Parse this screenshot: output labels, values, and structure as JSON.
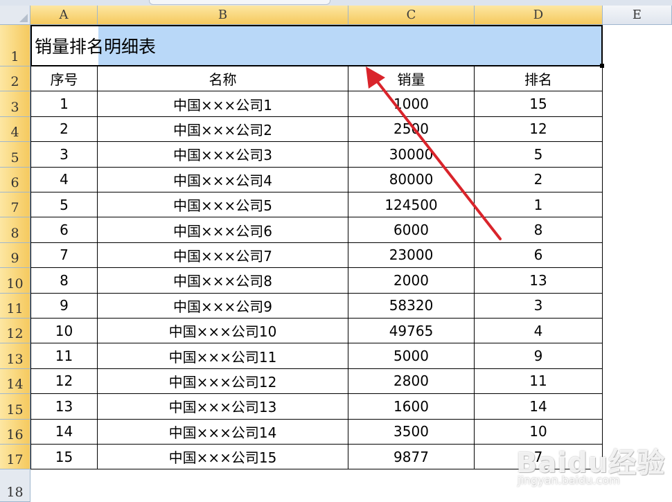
{
  "columns": [
    "A",
    "B",
    "C",
    "D",
    "E"
  ],
  "rows": [
    "1",
    "2",
    "3",
    "4",
    "5",
    "6",
    "7",
    "8",
    "9",
    "10",
    "11",
    "12",
    "13",
    "14",
    "15",
    "16",
    "17",
    "18"
  ],
  "title": "销量排名明细表",
  "headers": {
    "seq": "序号",
    "name": "名称",
    "sales": "销量",
    "rank": "排名"
  },
  "table": [
    {
      "seq": "1",
      "name": "中国×××公司1",
      "sales": "1000",
      "rank": "15"
    },
    {
      "seq": "2",
      "name": "中国×××公司2",
      "sales": "2500",
      "rank": "12"
    },
    {
      "seq": "3",
      "name": "中国×××公司3",
      "sales": "30000",
      "rank": "5"
    },
    {
      "seq": "4",
      "name": "中国×××公司4",
      "sales": "80000",
      "rank": "2"
    },
    {
      "seq": "5",
      "name": "中国×××公司5",
      "sales": "124500",
      "rank": "1"
    },
    {
      "seq": "6",
      "name": "中国×××公司6",
      "sales": "6000",
      "rank": "8"
    },
    {
      "seq": "7",
      "name": "中国×××公司7",
      "sales": "23000",
      "rank": "6"
    },
    {
      "seq": "8",
      "name": "中国×××公司8",
      "sales": "2000",
      "rank": "13"
    },
    {
      "seq": "9",
      "name": "中国×××公司9",
      "sales": "58320",
      "rank": "3"
    },
    {
      "seq": "10",
      "name": "中国×××公司10",
      "sales": "49765",
      "rank": "4"
    },
    {
      "seq": "11",
      "name": "中国×××公司11",
      "sales": "5000",
      "rank": "9"
    },
    {
      "seq": "12",
      "name": "中国×××公司12",
      "sales": "2800",
      "rank": "11"
    },
    {
      "seq": "13",
      "name": "中国×××公司13",
      "sales": "1600",
      "rank": "14"
    },
    {
      "seq": "14",
      "name": "中国×××公司14",
      "sales": "3500",
      "rank": "10"
    },
    {
      "seq": "15",
      "name": "中国×××公司15",
      "sales": "9877",
      "rank": "7"
    }
  ],
  "watermark": {
    "logo": "Baidu经验",
    "url": "jingyan.baidu.com"
  },
  "colors": {
    "selection": "#b9d8f8",
    "header_selected": "#f5c95e",
    "arrow": "#d9242b"
  }
}
